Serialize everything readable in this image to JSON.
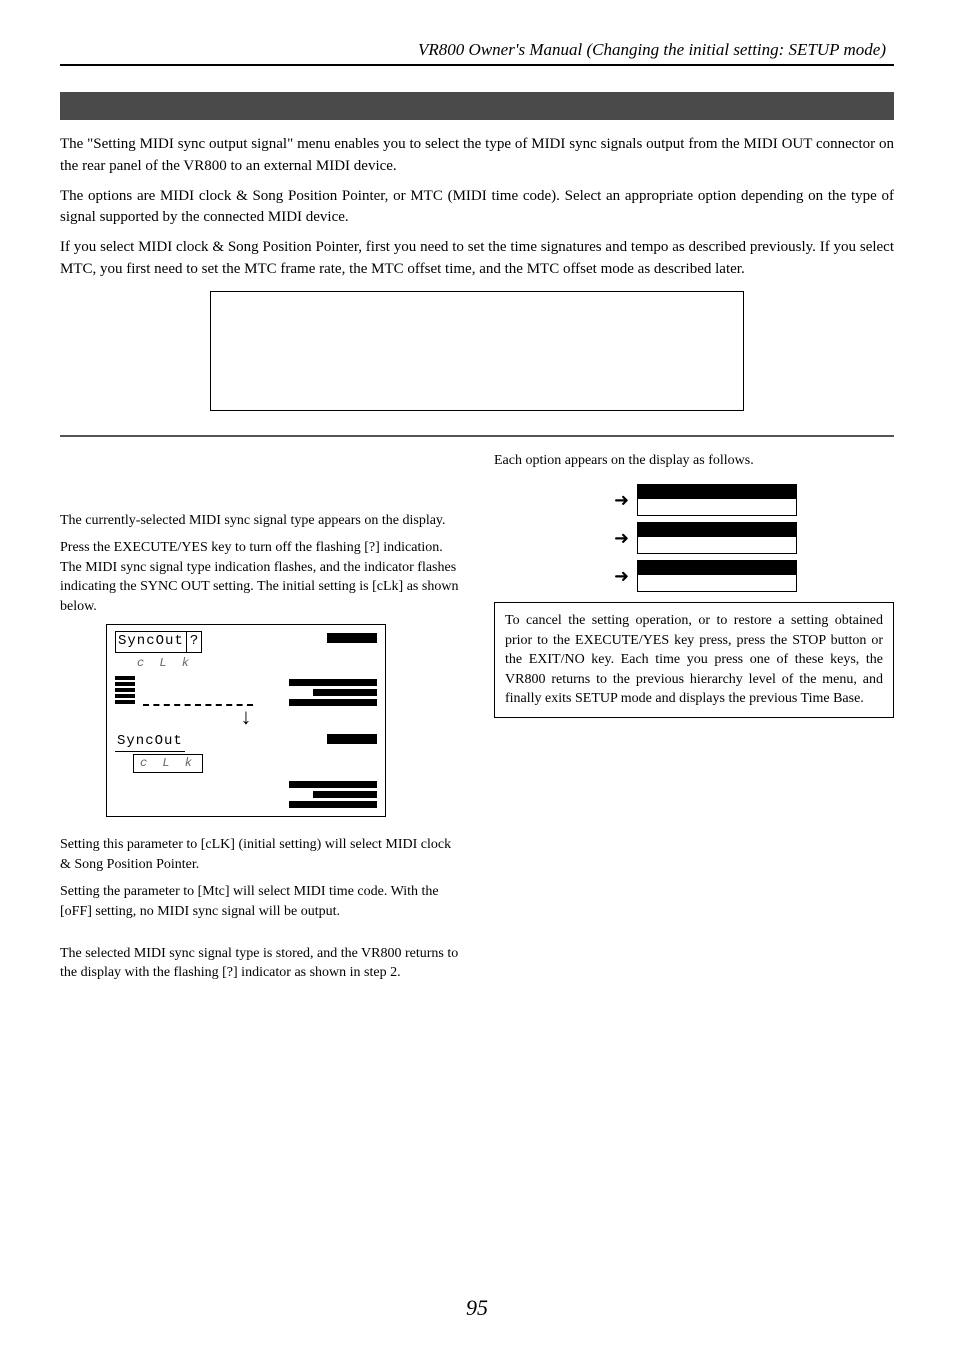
{
  "header": {
    "title": "VR800 Owner's Manual (Changing the initial setting: SETUP mode)"
  },
  "intro": {
    "p1": "The \"Setting MIDI sync output signal\" menu enables you to select the type of MIDI sync signals output from the MIDI OUT connector on the rear panel of the VR800 to an external MIDI device.",
    "p2": "The options are MIDI clock & Song Position Pointer, or MTC (MIDI time code).  Select an appropriate option depending on the type of signal supported by the connected MIDI device.",
    "p3": "If you select MIDI clock & Song Position Pointer, first you need to set the time signatures and tempo as described previously.  If you select MTC, you first need to set the MTC frame rate, the MTC offset time, and the MTC offset mode as described later."
  },
  "left": {
    "step2a": "The currently-selected MIDI sync signal type appears on the display.",
    "step2b": "Press the EXECUTE/YES key to turn off the flashing [?] indication.  The MIDI sync signal type indication flashes, and the indicator flashes indicating the SYNC OUT setting.  The initial setting is [cLk] as shown below.",
    "lcd1_title": "SyncOut",
    "lcd1_q": "?",
    "lcd1_sub": "c L k",
    "lcd2_title": "SyncOut",
    "lcd2_sub": "c L k",
    "step3a": "Setting this parameter to [cLK] (initial setting) will select MIDI clock & Song Position Pointer.",
    "step3b": "Setting the parameter to [Mtc] will select MIDI time code.  With the [oFF] setting, no MIDI sync signal will be output.",
    "step4": "The selected MIDI sync signal type is stored, and the VR800 returns to the display with the flashing [?] indicator as shown in step 2."
  },
  "right": {
    "optline": "Each option appears on the display as follows.",
    "cancel": "To cancel the setting operation, or to restore a setting obtained prior to the EXECUTE/YES key press, press the STOP button or the EXIT/NO key.  Each time you press one of these keys, the VR800 returns to the previous hierarchy level of the menu, and finally exits SETUP mode and displays the previous Time Base."
  },
  "page_number": "95"
}
